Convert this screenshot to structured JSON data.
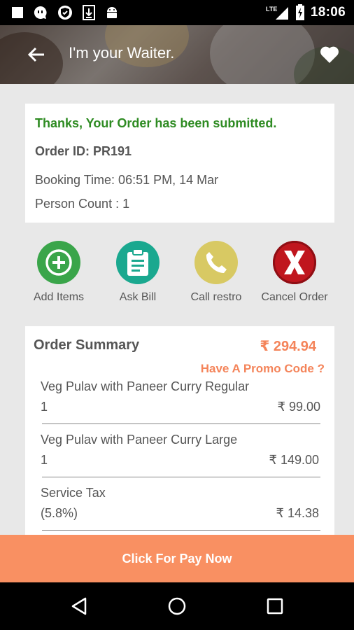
{
  "status_bar": {
    "time": "18:06",
    "network_label": "LTE",
    "left_icons": [
      "square-notification-icon",
      "chat-bubble-icon",
      "shield-icon",
      "download-icon",
      "android-icon"
    ],
    "right_icons": [
      "signal-icon",
      "battery-icon"
    ]
  },
  "header": {
    "title": "I'm your Waiter.",
    "back_icon": "arrow-left-icon",
    "favorite_icon": "heart-icon"
  },
  "order": {
    "success_message": "Thanks, Your Order has been submitted.",
    "order_id": "Order ID: PR191",
    "booking_time": "Booking Time: 06:51 PM, 14 Mar",
    "person_count": "Person Count : 1"
  },
  "actions": [
    {
      "label": "Add Items",
      "icon": "plus-circle-icon",
      "color": "#3aa54a"
    },
    {
      "label": "Ask Bill",
      "icon": "clipboard-icon",
      "color": "#1aa88f"
    },
    {
      "label": "Call restro",
      "icon": "phone-icon",
      "color": "#d8c963"
    },
    {
      "label": "Cancel Order",
      "icon": "x-icon",
      "color": "#c0161e"
    }
  ],
  "summary": {
    "title": "Order Summary",
    "total": "₹ 294.94",
    "promo": "Have A Promo Code ?",
    "items": [
      {
        "name": "Veg Pulav with Paneer Curry Regular",
        "qty": "1",
        "price": "₹ 99.00"
      },
      {
        "name": "Veg Pulav with Paneer Curry Large",
        "qty": "1",
        "price": "₹ 149.00"
      },
      {
        "name": "Service Tax",
        "qty": "(5.8%)",
        "price": "₹ 14.38"
      }
    ]
  },
  "pay_button": {
    "label": "Click For Pay Now"
  },
  "colors": {
    "accent": "#f99062",
    "success": "#2e8b22",
    "total": "#f4845a"
  },
  "nav_icons": [
    "back-triangle-icon",
    "home-circle-icon",
    "recents-square-icon"
  ]
}
